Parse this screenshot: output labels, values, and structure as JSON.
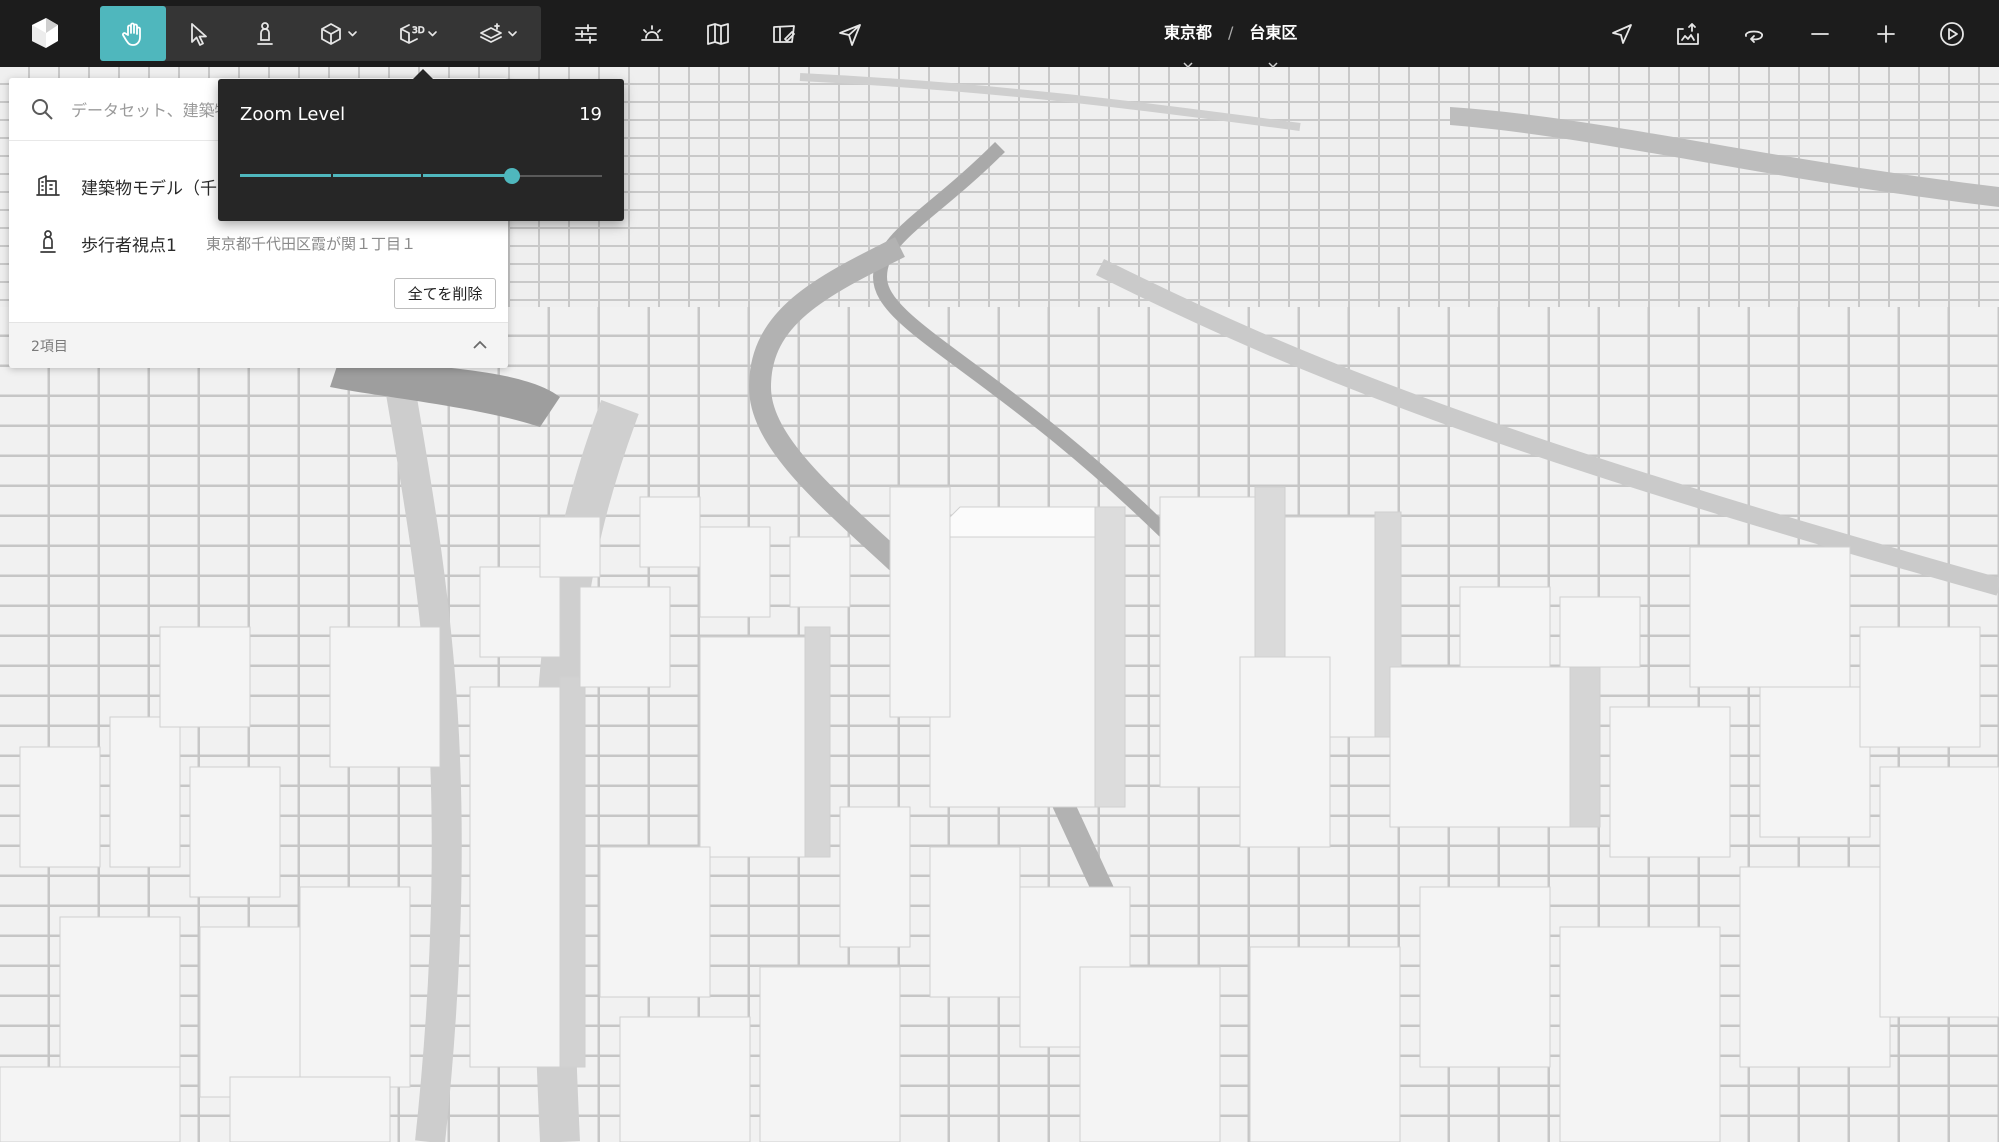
{
  "colors": {
    "toolbar_bg": "#1c1c1c",
    "accent": "#4fb7bd",
    "popover_bg": "#262626"
  },
  "toolbar": {
    "tools": [
      {
        "icon": "hand-icon",
        "active": true
      },
      {
        "icon": "pointer-icon"
      },
      {
        "icon": "pedestrian-icon"
      },
      {
        "icon": "cube-icon",
        "dropdown": true
      },
      {
        "icon": "cube-3d-icon",
        "dropdown": true
      },
      {
        "icon": "layers-icon",
        "dropdown": true
      },
      {
        "icon": "sliders-icon"
      },
      {
        "icon": "sun-icon"
      },
      {
        "icon": "map-book-icon"
      },
      {
        "icon": "map-edit-icon"
      },
      {
        "icon": "send-icon"
      }
    ],
    "right_tools": [
      {
        "icon": "location-arrow-icon"
      },
      {
        "icon": "screenshot-export-icon"
      },
      {
        "icon": "rotate-icon"
      },
      {
        "icon": "zoom-out-icon"
      },
      {
        "icon": "zoom-in-icon"
      },
      {
        "icon": "play-icon"
      }
    ]
  },
  "breadcrumb": {
    "prefecture": "東京都",
    "separator": "/",
    "ward": "台東区"
  },
  "search": {
    "placeholder": "データセット、建築物を検索"
  },
  "items": [
    {
      "title": "建築物モデル（千",
      "subtitle": "",
      "icon": "building-icon"
    },
    {
      "title": "歩行者視点1",
      "subtitle": "東京都千代田区霞が関１丁目１",
      "icon": "pedestrian-icon"
    }
  ],
  "delete_all_label": "全てを削除",
  "item_count": "2項目",
  "zoom": {
    "label": "Zoom Level",
    "value": "19",
    "fraction": 0.75
  }
}
